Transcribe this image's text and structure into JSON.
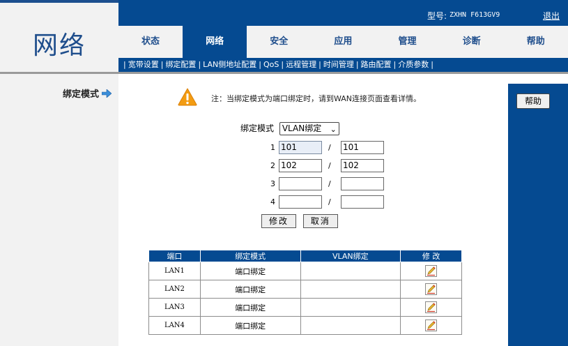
{
  "brand": {
    "title": "网络"
  },
  "header": {
    "model_label": "型号:",
    "model_value": "ZXHN F613GV9",
    "logout": "退出"
  },
  "tabs": [
    {
      "label": "状态",
      "active": false
    },
    {
      "label": "网络",
      "active": true
    },
    {
      "label": "安全",
      "active": false
    },
    {
      "label": "应用",
      "active": false
    },
    {
      "label": "管理",
      "active": false
    },
    {
      "label": "诊断",
      "active": false
    },
    {
      "label": "帮助",
      "active": false
    }
  ],
  "subnav": [
    {
      "label": "宽带设置",
      "active": false
    },
    {
      "label": "绑定配置",
      "active": true
    },
    {
      "label": "LAN侧地址配置",
      "active": false
    },
    {
      "label": "QoS",
      "active": false
    },
    {
      "label": "远程管理",
      "active": false
    },
    {
      "label": "时间管理",
      "active": false
    },
    {
      "label": "路由配置",
      "active": false
    },
    {
      "label": "介质参数",
      "active": false
    }
  ],
  "sidebar": {
    "current": "绑定模式"
  },
  "note": {
    "text": "注：当绑定模式为端口绑定时，请到WAN连接页面查看详情。"
  },
  "form": {
    "mode_label": "绑定模式",
    "mode_value": "VLAN绑定",
    "rows": [
      {
        "index": "1",
        "left": "101",
        "right": "101"
      },
      {
        "index": "2",
        "left": "102",
        "right": "102"
      },
      {
        "index": "3",
        "left": "",
        "right": ""
      },
      {
        "index": "4",
        "left": "",
        "right": ""
      }
    ],
    "slash": "/",
    "modify_button": "修改",
    "cancel_button": "取消"
  },
  "table": {
    "headers": [
      "端口",
      "绑定模式",
      "VLAN绑定",
      "修 改"
    ],
    "rows": [
      {
        "port": "LAN1",
        "mode": "端口绑定",
        "vlan": ""
      },
      {
        "port": "LAN2",
        "mode": "端口绑定",
        "vlan": ""
      },
      {
        "port": "LAN3",
        "mode": "端口绑定",
        "vlan": ""
      },
      {
        "port": "LAN4",
        "mode": "端口绑定",
        "vlan": ""
      }
    ]
  },
  "help_button": "帮助",
  "colors": {
    "primary_blue": "#054a91",
    "left_bg": "#f2f2f2",
    "warning_orange": "#f39c12"
  }
}
